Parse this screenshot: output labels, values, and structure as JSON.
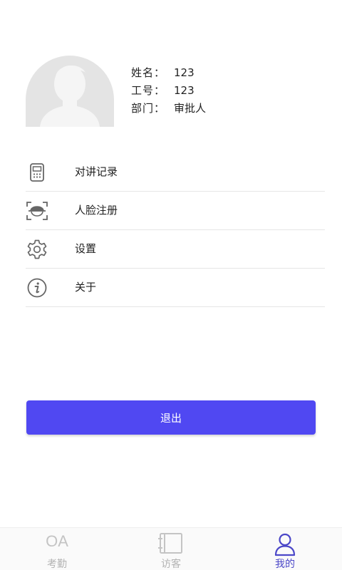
{
  "profile": {
    "name_label": "姓名：",
    "name_value": "123",
    "id_label": "工号：",
    "id_value": "123",
    "dept_label": "部门：",
    "dept_value": "审批人"
  },
  "menu": {
    "items": [
      {
        "label": "对讲记录",
        "icon": "intercom-device-icon"
      },
      {
        "label": "人脸注册",
        "icon": "face-scan-icon"
      },
      {
        "label": "设置",
        "icon": "gear-icon"
      },
      {
        "label": "关于",
        "icon": "info-icon"
      }
    ]
  },
  "logout": {
    "label": "退出"
  },
  "tabbar": {
    "tabs": [
      {
        "label": "考勤",
        "icon_text": "OA",
        "icon": "oa-icon",
        "active": false
      },
      {
        "label": "访客",
        "icon": "visitor-book-icon",
        "active": false
      },
      {
        "label": "我的",
        "icon": "person-icon",
        "active": true
      }
    ]
  },
  "colors": {
    "accent": "#5048f2",
    "active_tab": "#4b47c8",
    "inactive_tab": "#b3b3b3",
    "icon_gray": "#666666",
    "avatar_bg": "#e4e4e4",
    "avatar_fg": "#f5f5f5"
  }
}
